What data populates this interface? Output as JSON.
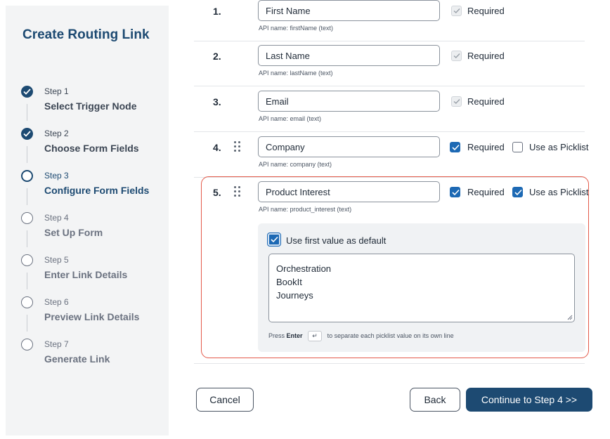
{
  "sidebar": {
    "title": "Create Routing Link",
    "steps": [
      {
        "num": "Step 1",
        "name": "Select Trigger Node",
        "status": "done"
      },
      {
        "num": "Step 2",
        "name": "Choose Form Fields",
        "status": "done"
      },
      {
        "num": "Step 3",
        "name": "Configure Form Fields",
        "status": "current"
      },
      {
        "num": "Step 4",
        "name": "Set Up Form",
        "status": "todo"
      },
      {
        "num": "Step 5",
        "name": "Enter Link Details",
        "status": "todo"
      },
      {
        "num": "Step 6",
        "name": "Preview Link Details",
        "status": "todo"
      },
      {
        "num": "Step 7",
        "name": "Generate Link",
        "status": "todo"
      }
    ]
  },
  "fields": [
    {
      "index": "1.",
      "value": "First Name",
      "api": "API name: firstName (text)",
      "required_label": "Required",
      "required": true,
      "required_disabled": true
    },
    {
      "index": "2.",
      "value": "Last Name",
      "api": "API name: lastName (text)",
      "required_label": "Required",
      "required": true,
      "required_disabled": true
    },
    {
      "index": "3.",
      "value": "Email",
      "api": "API name: email (text)",
      "required_label": "Required",
      "required": true,
      "required_disabled": true
    },
    {
      "index": "4.",
      "value": "Company",
      "api": "API name: company (text)",
      "required_label": "Required",
      "required": true,
      "picklist_label": "Use as Picklist",
      "picklist": false
    },
    {
      "index": "5.",
      "value": "Product Interest",
      "api": "API name: product_interest (text)",
      "required_label": "Required",
      "required": true,
      "picklist_label": "Use as Picklist",
      "picklist": true
    }
  ],
  "picklist": {
    "default_label": "Use first value as default",
    "default_checked": true,
    "values": [
      "Orchestration",
      "BookIt",
      "Journeys"
    ],
    "hint_prefix": "Press",
    "hint_key": "Enter",
    "hint_symbol": "↵",
    "hint_suffix": "to separate each picklist value on its own line"
  },
  "buttons": {
    "cancel": "Cancel",
    "back": "Back",
    "continue": "Continue to Step 4 >>"
  },
  "colors": {
    "brand": "#1d4a72",
    "checkbox": "#1d69b4",
    "highlight": "#e45a4a"
  }
}
